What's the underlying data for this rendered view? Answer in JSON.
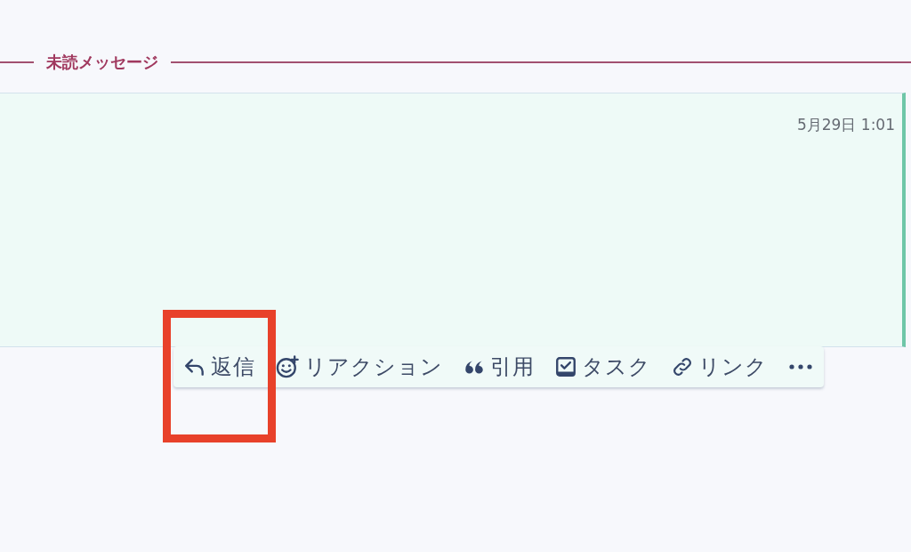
{
  "unread_divider": {
    "label": "未読メッセージ"
  },
  "message": {
    "timestamp": "5月29日 1:01"
  },
  "message_actions": [
    {
      "kind": "reply",
      "label": "返信",
      "highlighted": true
    },
    {
      "kind": "reaction",
      "label": "リアクション",
      "highlighted": false
    },
    {
      "kind": "quote",
      "label": "引用",
      "highlighted": false
    },
    {
      "kind": "task",
      "label": "タスク",
      "highlighted": false
    },
    {
      "kind": "link",
      "label": "リンク",
      "highlighted": false
    },
    {
      "kind": "more",
      "highlighted": false
    }
  ]
}
